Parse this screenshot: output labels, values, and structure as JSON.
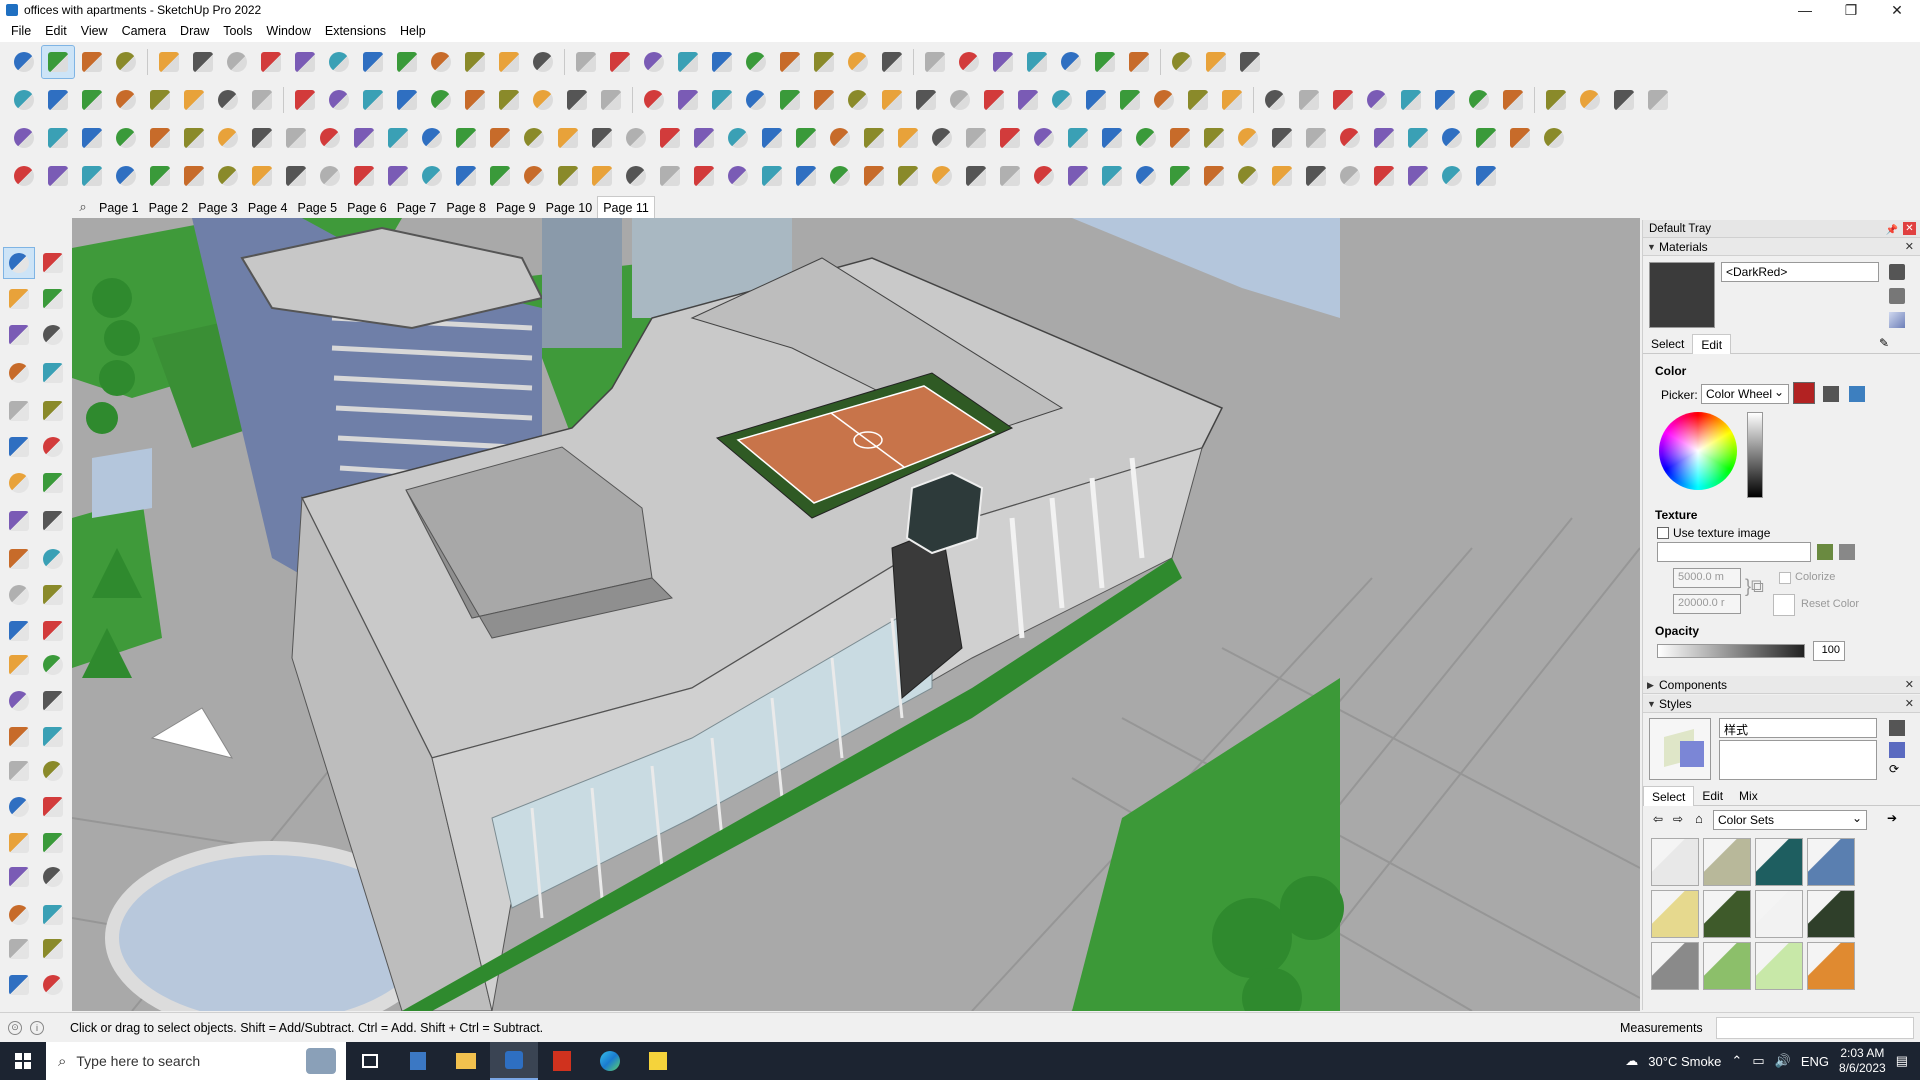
{
  "window": {
    "title": "offices with apartments - SketchUp Pro 2022",
    "minimize_glyph": "—",
    "maximize_glyph": "❐",
    "close_glyph": "✕"
  },
  "menu": [
    "File",
    "Edit",
    "View",
    "Camera",
    "Draw",
    "Tools",
    "Window",
    "Extensions",
    "Help"
  ],
  "scenes": {
    "search_glyph": "⌕",
    "tabs": [
      "Page 1",
      "Page 2",
      "Page 3",
      "Page 4",
      "Page 5",
      "Page 6",
      "Page 7",
      "Page 8",
      "Page 9",
      "Page 10",
      "Page 11"
    ],
    "active": "Page 11"
  },
  "tray": {
    "title": "Default Tray",
    "pin_glyph": "📌",
    "close_glyph": "✕",
    "materials": {
      "header": "Materials",
      "current_name": "<DarkRed>",
      "tabs": [
        "Select",
        "Edit"
      ],
      "active_tab": "Edit",
      "color_label": "Color",
      "picker_label": "Picker:",
      "picker_value": "Color Wheel",
      "current_color": "#b22222",
      "swatch_color": "#3b3b3b",
      "texture_label": "Texture",
      "use_texture_label": "Use texture image",
      "width_value": "5000.0 m",
      "height_value": "20000.0 r",
      "colorize_label": "Colorize",
      "reset_color_label": "Reset Color",
      "opacity_label": "Opacity",
      "opacity_value": "100"
    },
    "components": {
      "header": "Components"
    },
    "styles": {
      "header": "Styles",
      "name_value": "样式",
      "tabs": [
        "Select",
        "Edit",
        "Mix"
      ],
      "active_tab": "Select",
      "collection": "Color Sets",
      "thumbnails": [
        "#e8e8e8",
        "#b8b89a",
        "#1e5e60",
        "#5a7fb0",
        "#e6d98e",
        "#3e5a2a",
        "#f2f2f2",
        "#2f3f2a",
        "#8a8a8a",
        "#8cbf6a",
        "#c8e8a8",
        "#e08a30"
      ]
    }
  },
  "status": {
    "message": "Click or drag to select objects. Shift = Add/Subtract. Ctrl = Add. Shift + Ctrl = Subtract.",
    "measurements_label": "Measurements"
  },
  "taskbar": {
    "search_placeholder": "Type here to search",
    "weather": "30°C  Smoke",
    "language": "ENG",
    "time": "2:03 AM",
    "date": "8/6/2023"
  }
}
